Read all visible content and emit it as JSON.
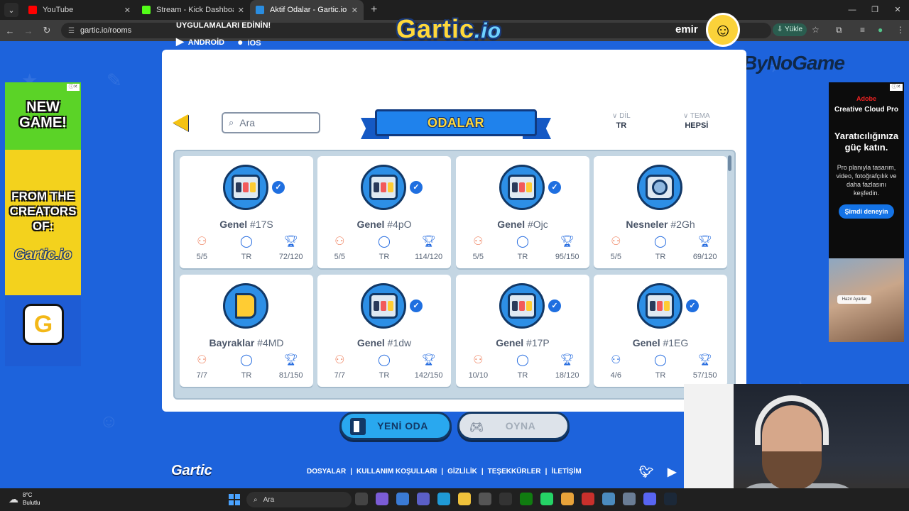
{
  "browser": {
    "tabs": [
      {
        "title": "YouTube",
        "color": "#ff0000",
        "active": false
      },
      {
        "title": "Stream - Kick Dashboard",
        "color": "#53fc18",
        "active": false
      },
      {
        "title": "Aktif Odalar - Gartic.io",
        "color": "#2a8de0",
        "active": true
      }
    ],
    "url": "gartic.io/rooms",
    "install_label": "Yükle"
  },
  "header": {
    "apps_title": "UYGULAMALARI EDİNİN!",
    "android_label": "ANDROİD",
    "ios_label": "iOS",
    "logo_text": "Gartic",
    "logo_suffix": ".io",
    "username": "emir",
    "sponsor": "ByNoGame"
  },
  "ad_left": {
    "line1": "NEW GAME!",
    "line2": "FROM THE CREATORS OF:",
    "line3": "Gartic.io",
    "badge": "G"
  },
  "ad_right": {
    "brand": "Adobe",
    "product": "Creative Cloud Pro",
    "headline": "Yaratıcılığınıza güç katın.",
    "body": "Pro planıyla tasarım, video, fotoğrafçılık ve daha fazlasını keşfedin.",
    "cta": "Şimdi deneyin",
    "chip": "Hazır Ayarlar"
  },
  "toolbar": {
    "search_placeholder": "Ara",
    "title": "ODALAR",
    "lang_label": "DİL",
    "lang_value": "TR",
    "theme_label": "TEMA",
    "theme_value": "HEPSİ"
  },
  "rooms": [
    {
      "category": "Genel",
      "code": "#17S",
      "icon": "slot-machine-icon",
      "verified": true,
      "players": "5/5",
      "lang": "TR",
      "points": "72/120",
      "full": true
    },
    {
      "category": "Genel",
      "code": "#4pO",
      "icon": "slot-machine-icon",
      "verified": true,
      "players": "5/5",
      "lang": "TR",
      "points": "114/120",
      "full": true
    },
    {
      "category": "Genel",
      "code": "#Ojc",
      "icon": "slot-machine-icon",
      "verified": true,
      "players": "5/5",
      "lang": "TR",
      "points": "95/150",
      "full": true
    },
    {
      "category": "Nesneler",
      "code": "#2Gh",
      "icon": "camera-icon",
      "verified": false,
      "players": "5/5",
      "lang": "TR",
      "points": "69/120",
      "full": true
    },
    {
      "category": "Bayraklar",
      "code": "#4MD",
      "icon": "flag-icon",
      "verified": false,
      "players": "7/7",
      "lang": "TR",
      "points": "81/150",
      "full": true
    },
    {
      "category": "Genel",
      "code": "#1dw",
      "icon": "slot-machine-icon",
      "verified": true,
      "players": "7/7",
      "lang": "TR",
      "points": "142/150",
      "full": true
    },
    {
      "category": "Genel",
      "code": "#17P",
      "icon": "slot-machine-icon",
      "verified": true,
      "players": "10/10",
      "lang": "TR",
      "points": "18/120",
      "full": true
    },
    {
      "category": "Genel",
      "code": "#1EG",
      "icon": "slot-machine-icon",
      "verified": true,
      "players": "4/6",
      "lang": "TR",
      "points": "57/150",
      "full": false
    }
  ],
  "actions": {
    "new_room": "YENİ ODA",
    "play": "OYNA"
  },
  "footer": {
    "logo": "Gartic",
    "links": [
      "DOSYALAR",
      "KULLANIM KOŞULLARI",
      "GİZLİLİK",
      "TEŞEKKÜRLER",
      "İLETİŞİM"
    ]
  },
  "taskbar": {
    "temperature": "8°C",
    "weather": "Bulutlu",
    "search_placeholder": "Ara"
  }
}
